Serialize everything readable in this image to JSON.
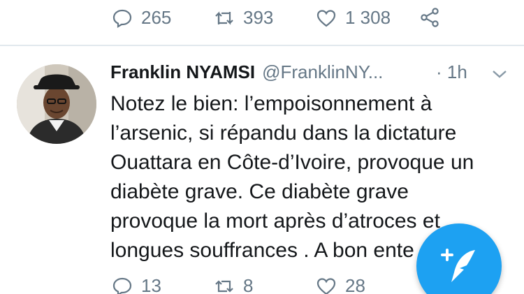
{
  "top_actions": {
    "reply_count": "265",
    "retweet_count": "393",
    "like_count": "1 308"
  },
  "tweet": {
    "author_name": "Franklin NYAMSI",
    "author_handle": "@FranklinNY...",
    "time": "· 1h",
    "text_lines": [
      "Notez le bien: l’empoisonnement à",
      "l’arsenic, si répandu dans la dictature",
      "Ouattara en Côte-d’Ivoire, provoque un",
      "diabète grave. Ce diabète grave",
      "provoque la mort après d’atroces et",
      "longues souffrances . A bon ente"
    ],
    "reply_count": "13",
    "retweet_count": "8",
    "like_count": "28"
  },
  "colors": {
    "accent": "#1da1f2",
    "muted": "#657786",
    "text": "#14171a"
  },
  "icons": {
    "reply": "reply-icon",
    "retweet": "retweet-icon",
    "like": "heart-icon",
    "share": "share-icon",
    "compose": "compose-tweet-icon",
    "menu": "chevron-down-icon"
  }
}
